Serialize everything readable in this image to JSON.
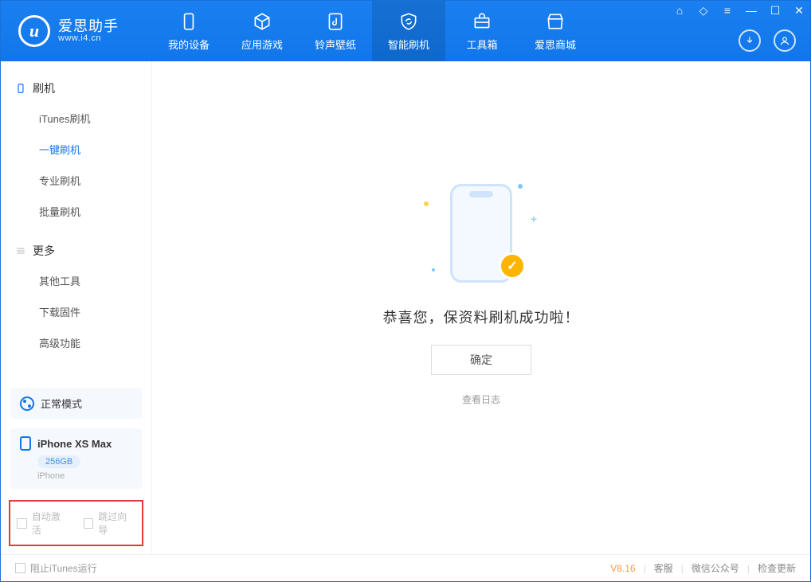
{
  "app": {
    "name_zh": "爱思助手",
    "url": "www.i4.cn",
    "logo_letter": "u"
  },
  "header_tabs": [
    {
      "label": "我的设备"
    },
    {
      "label": "应用游戏"
    },
    {
      "label": "铃声壁纸"
    },
    {
      "label": "智能刷机"
    },
    {
      "label": "工具箱"
    },
    {
      "label": "爱思商城"
    }
  ],
  "sidebar": {
    "group1": {
      "title": "刷机",
      "items": [
        "iTunes刷机",
        "一键刷机",
        "专业刷机",
        "批量刷机"
      ],
      "active_index": 1
    },
    "group2": {
      "title": "更多",
      "items": [
        "其他工具",
        "下载固件",
        "高级功能"
      ]
    }
  },
  "mode": {
    "label": "正常模式"
  },
  "device": {
    "name": "iPhone XS Max",
    "capacity": "256GB",
    "type": "iPhone"
  },
  "checkboxes": {
    "auto_activate": "自动激活",
    "skip_wizard": "跳过向导"
  },
  "main": {
    "success_text": "恭喜您，保资料刷机成功啦！",
    "ok_button": "确定",
    "view_log": "查看日志"
  },
  "footer": {
    "block_itunes": "阻止iTunes运行",
    "version": "V8.16",
    "links": [
      "客服",
      "微信公众号",
      "检查更新"
    ]
  }
}
